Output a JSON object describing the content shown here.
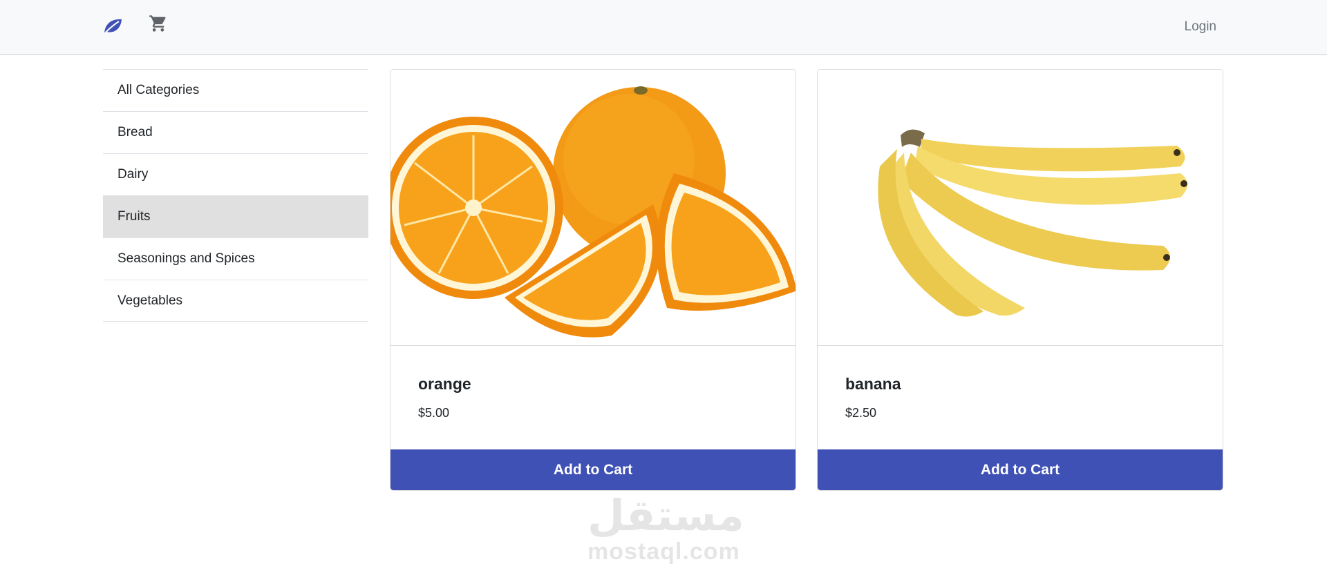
{
  "navbar": {
    "brand_icon": "leaf-icon",
    "cart_icon": "cart-icon",
    "login_label": "Login",
    "accent_color": "#3f51b5"
  },
  "sidebar": {
    "items": [
      {
        "label": "All Categories",
        "active": false
      },
      {
        "label": "Bread",
        "active": false
      },
      {
        "label": "Dairy",
        "active": false
      },
      {
        "label": "Fruits",
        "active": true
      },
      {
        "label": "Seasonings and Spices",
        "active": false
      },
      {
        "label": "Vegetables",
        "active": false
      }
    ]
  },
  "products": [
    {
      "name": "orange",
      "price": "$5.00",
      "button_label": "Add to Cart"
    },
    {
      "name": "banana",
      "price": "$2.50",
      "button_label": "Add to Cart"
    }
  ],
  "watermark": {
    "arabic": "مستقل",
    "latin": "mostaql.com"
  }
}
